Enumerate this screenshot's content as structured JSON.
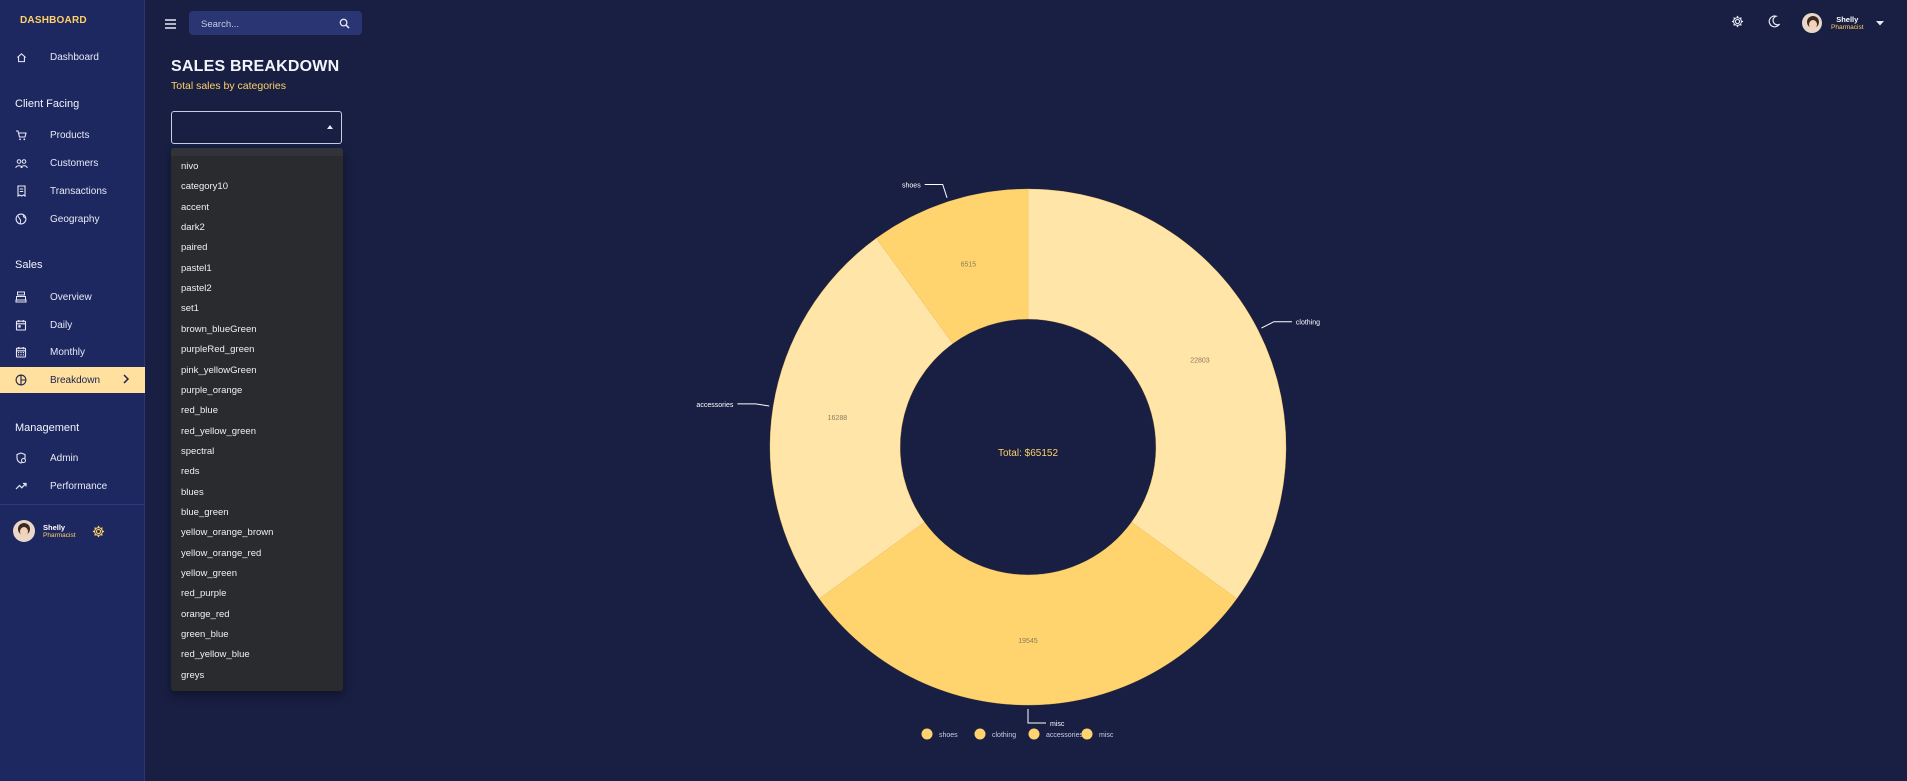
{
  "brand": "DASHBOARD",
  "sidebar": {
    "dashboard": "Dashboard",
    "sections": [
      "Client Facing",
      "Sales",
      "Management"
    ],
    "client_facing": [
      "Products",
      "Customers",
      "Transactions",
      "Geography"
    ],
    "sales": [
      "Overview",
      "Daily",
      "Monthly",
      "Breakdown"
    ],
    "management": [
      "Admin",
      "Performance"
    ],
    "active_item": "Breakdown",
    "user": {
      "name": "Shelly",
      "role": "Pharmacist"
    }
  },
  "topbar": {
    "search_placeholder": "Search...",
    "user": {
      "name": "Shelly",
      "role": "Pharmacist"
    }
  },
  "page": {
    "title": "SALES BREAKDOWN",
    "subtitle": "Total sales by categories"
  },
  "color_select": {
    "options": [
      "nivo",
      "category10",
      "accent",
      "dark2",
      "paired",
      "pastel1",
      "pastel2",
      "set1",
      "brown_blueGreen",
      "purpleRed_green",
      "pink_yellowGreen",
      "purple_orange",
      "red_blue",
      "red_yellow_green",
      "spectral",
      "reds",
      "blues",
      "blue_green",
      "yellow_orange_brown",
      "yellow_orange_red",
      "yellow_green",
      "red_purple",
      "orange_red",
      "green_blue",
      "red_yellow_blue",
      "greys"
    ]
  },
  "colors": {
    "background": "#181f43",
    "sidebar": "#1e2860",
    "accent": "#ffd166",
    "slice_light": "#ffe5a8",
    "slice_dark": "#ffd36e"
  },
  "chart_data": {
    "type": "pie",
    "donut": true,
    "center_label": "Total: $65152",
    "slices": [
      {
        "label": "clothing",
        "value": 22803,
        "color": "#ffe5a8"
      },
      {
        "label": "misc",
        "value": 19545,
        "color": "#ffd36e"
      },
      {
        "label": "accessories",
        "value": 16288,
        "color": "#ffe5a8"
      },
      {
        "label": "shoes",
        "value": 6515,
        "color": "#ffd36e"
      }
    ],
    "legend": [
      "shoes",
      "clothing",
      "accessories",
      "misc"
    ],
    "legend_position": "bottom"
  }
}
